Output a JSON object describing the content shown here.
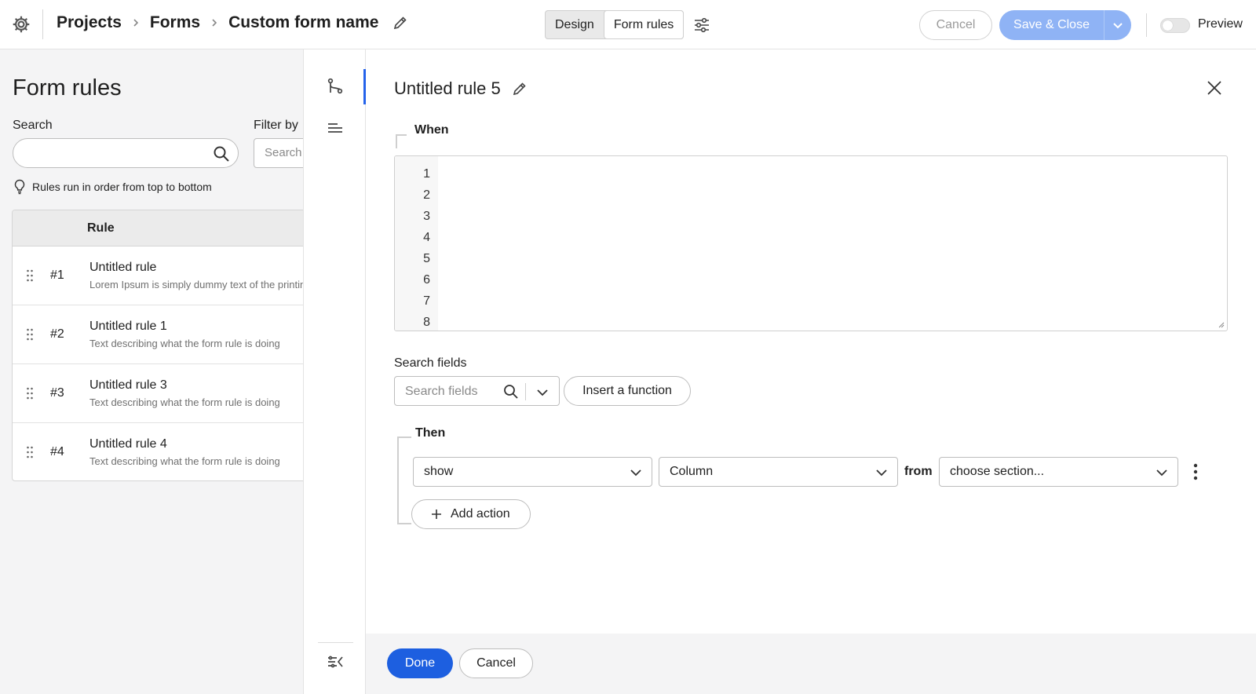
{
  "header": {
    "breadcrumbs": [
      "Projects",
      "Forms",
      "Custom form name"
    ],
    "tabs": [
      {
        "label": "Design",
        "active": false
      },
      {
        "label": "Form rules",
        "active": true
      }
    ],
    "cancel_label": "Cancel",
    "save_label": "Save & Close",
    "preview_label": "Preview",
    "preview_enabled": false
  },
  "left_panel": {
    "title": "Form rules",
    "search_label": "Search",
    "search_value": "",
    "filter_label": "Filter by",
    "filter_placeholder": "Search",
    "hint": "Rules run in order from top to bottom",
    "column_header": "Rule",
    "rules": [
      {
        "number": "#1",
        "title": "Untitled rule",
        "description": "Lorem Ipsum is simply dummy text of the printing"
      },
      {
        "number": "#2",
        "title": "Untitled rule 1",
        "description": "Text describing what the form rule is doing"
      },
      {
        "number": "#3",
        "title": "Untitled rule 3",
        "description": "Text describing what the form rule is doing"
      },
      {
        "number": "#4",
        "title": "Untitled rule 4",
        "description": "Text describing what the form rule is doing"
      }
    ]
  },
  "editor": {
    "rule_name": "Untitled rule 5",
    "when_label": "When",
    "line_numbers": [
      "1",
      "2",
      "3",
      "4",
      "5",
      "6",
      "7",
      "8"
    ],
    "search_fields_label": "Search fields",
    "search_fields_placeholder": "Search fields",
    "insert_function_label": "Insert a function",
    "then_label": "Then",
    "action_select": "show",
    "target_select": "Column",
    "from_label": "from",
    "section_select": "choose section...",
    "add_action_label": "Add action"
  },
  "footer": {
    "done_label": "Done",
    "cancel_label": "Cancel"
  },
  "colors": {
    "primary": "#1d5fe0",
    "primary_disabled": "#8fb3f5",
    "rail_active": "#2563eb",
    "panel_bg": "#f4f4f5"
  },
  "icons": [
    "gear-icon",
    "chevron-right-icon",
    "pencil-icon",
    "sliders-icon",
    "chevron-down-icon",
    "search-icon",
    "lightbulb-icon",
    "drag-handle-icon",
    "branch-icon",
    "lines-icon",
    "collapse-panel-icon",
    "close-icon",
    "plus-icon",
    "kebab-icon"
  ]
}
